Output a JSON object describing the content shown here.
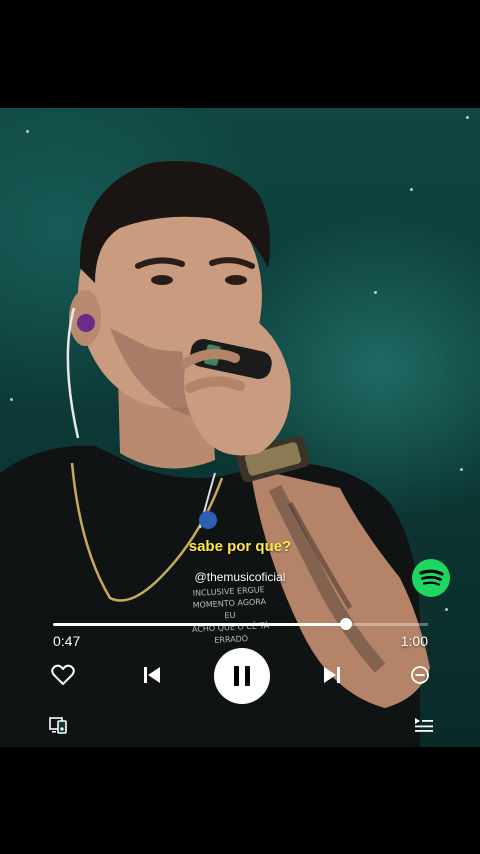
{
  "player": {
    "lyric_line": "sabe por que?",
    "handle": "@themusicoficial",
    "shirt_text": [
      "INCLUSIVE ERGUE",
      "MOMENTO AGORA EU",
      "ACHO QUE O CÊ TÁ",
      "ERRADO"
    ],
    "current_time": "0:47",
    "total_time": "1:00",
    "progress_fraction": 0.78,
    "state": "playing"
  },
  "colors": {
    "lyric": "#ffe84a",
    "spotify_green": "#1ed760",
    "background_teal": "#0f4642"
  },
  "icons": [
    "heart-icon",
    "skip-previous-icon",
    "pause-icon",
    "skip-next-icon",
    "minus-circle-icon",
    "devices-icon",
    "queue-icon",
    "spotify-logo-icon"
  ]
}
